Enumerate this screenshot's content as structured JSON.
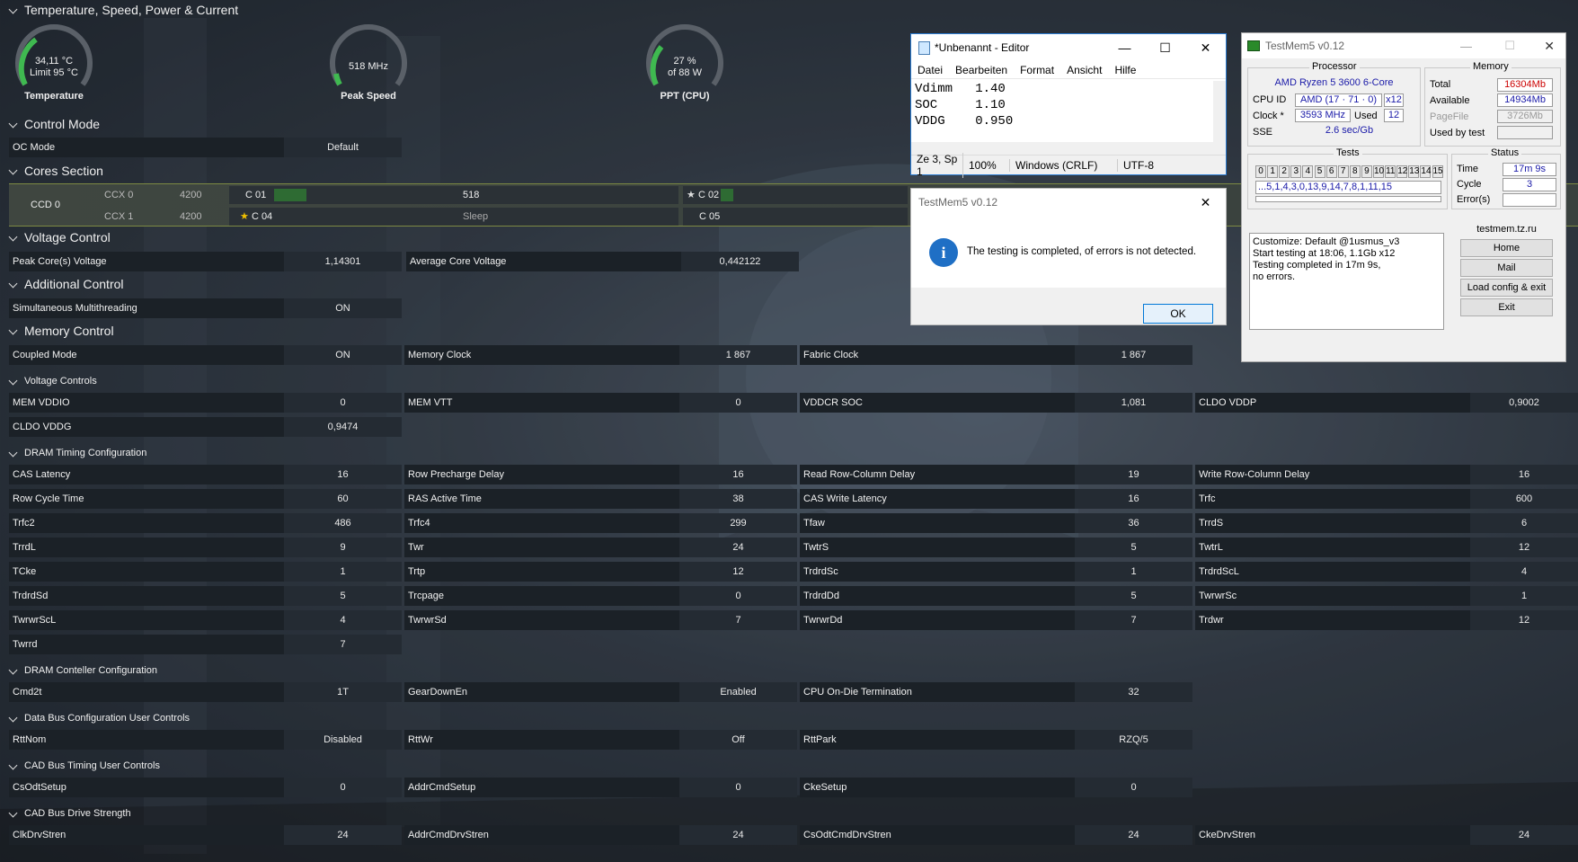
{
  "sections": {
    "temp": "Temperature, Speed, Power & Current",
    "control": "Control Mode",
    "cores": "Cores Section",
    "voltage": "Voltage Control",
    "additional": "Additional Control",
    "memory": "Memory Control",
    "vcontrols": "Voltage Controls",
    "dram": "DRAM Timing Configuration",
    "dramctl": "DRAM Conteller Configuration",
    "databus": "Data Bus Configuration User Controls",
    "cadtiming": "CAD Bus Timing User Controls",
    "caddrive": "CAD Bus Drive Strength"
  },
  "gauges": [
    {
      "l1": "34,11 °C",
      "l2": "Limit 95 °C",
      "cap": "Temperature",
      "fill": 0.36
    },
    {
      "l1": "518  MHz",
      "l2": "",
      "cap": "Peak Speed",
      "fill": 0.1
    },
    {
      "l1": "27 %",
      "l2": "of 88 W",
      "cap": "PPT (CPU)",
      "fill": 0.27
    }
  ],
  "oc": {
    "label": "OC Mode",
    "value": "Default"
  },
  "cores": {
    "ccd": "CCD 0",
    "ccx0": "CCX 0",
    "ccx0_freq": "4200",
    "ccx1": "CCX 1",
    "ccx1_freq": "4200",
    "c01": "C 01",
    "c01_val": "518",
    "c02": "C 02",
    "c04": "C 04",
    "c04_val": "Sleep",
    "c05": "C 05"
  },
  "voltage": [
    {
      "label": "Peak Core(s) Voltage",
      "value": "1,14301"
    },
    {
      "label": "Average Core Voltage",
      "value": "0,442122"
    }
  ],
  "smt": {
    "label": "Simultaneous Multithreading",
    "value": "ON"
  },
  "memctl": [
    {
      "label": "Coupled Mode",
      "value": "ON"
    },
    {
      "label": "Memory Clock",
      "value": "1 867"
    },
    {
      "label": "Fabric Clock",
      "value": "1 867"
    }
  ],
  "vctl": [
    {
      "label": "MEM VDDIO",
      "value": "0"
    },
    {
      "label": "MEM VTT",
      "value": "0"
    },
    {
      "label": "VDDCR SOC",
      "value": "1,081"
    },
    {
      "label": "CLDO VDDP",
      "value": "0,9002"
    },
    {
      "label": "CLDO VDDG",
      "value": "0,9474"
    }
  ],
  "timings": [
    {
      "label": "CAS Latency",
      "value": "16"
    },
    {
      "label": "Row Precharge Delay",
      "value": "16"
    },
    {
      "label": "Read Row-Column Delay",
      "value": "19"
    },
    {
      "label": "Write Row-Column Delay",
      "value": "16"
    },
    {
      "label": "Row Cycle Time",
      "value": "60"
    },
    {
      "label": "RAS Active Time",
      "value": "38"
    },
    {
      "label": "CAS Write Latency",
      "value": "16"
    },
    {
      "label": "Trfc",
      "value": "600"
    },
    {
      "label": "Trfc2",
      "value": "486"
    },
    {
      "label": "Trfc4",
      "value": "299"
    },
    {
      "label": "Tfaw",
      "value": "36"
    },
    {
      "label": "TrrdS",
      "value": "6"
    },
    {
      "label": "TrrdL",
      "value": "9"
    },
    {
      "label": "Twr",
      "value": "24"
    },
    {
      "label": "TwtrS",
      "value": "5"
    },
    {
      "label": "TwtrL",
      "value": "12"
    },
    {
      "label": "TCke",
      "value": "1"
    },
    {
      "label": "Trtp",
      "value": "12"
    },
    {
      "label": "TrdrdSc",
      "value": "1"
    },
    {
      "label": "TrdrdScL",
      "value": "4"
    },
    {
      "label": "TrdrdSd",
      "value": "5"
    },
    {
      "label": "Trcpage",
      "value": "0"
    },
    {
      "label": "TrdrdDd",
      "value": "5"
    },
    {
      "label": "TwrwrSc",
      "value": "1"
    },
    {
      "label": "TwrwrScL",
      "value": "4"
    },
    {
      "label": "TwrwrSd",
      "value": "7"
    },
    {
      "label": "TwrwrDd",
      "value": "7"
    },
    {
      "label": "Trdwr",
      "value": "12"
    },
    {
      "label": "Twrrd",
      "value": "7"
    }
  ],
  "dramctl": [
    {
      "label": "Cmd2t",
      "value": "1T"
    },
    {
      "label": "GearDownEn",
      "value": "Enabled"
    },
    {
      "label": "CPU On-Die Termination",
      "value": "32"
    }
  ],
  "databus": [
    {
      "label": "RttNom",
      "value": "Disabled"
    },
    {
      "label": "RttWr",
      "value": "Off"
    },
    {
      "label": "RttPark",
      "value": "RZQ/5"
    }
  ],
  "cadtiming": [
    {
      "label": "CsOdtSetup",
      "value": "0"
    },
    {
      "label": "AddrCmdSetup",
      "value": "0"
    },
    {
      "label": "CkeSetup",
      "value": "0"
    }
  ],
  "caddrive": [
    {
      "label": "ClkDrvStren",
      "value": "24"
    },
    {
      "label": "AddrCmdDrvStren",
      "value": "24"
    },
    {
      "label": "CsOdtCmdDrvStren",
      "value": "24"
    },
    {
      "label": "CkeDrvStren",
      "value": "24"
    }
  ],
  "editor": {
    "title": "*Unbenannt - Editor",
    "menu": [
      "Datei",
      "Bearbeiten",
      "Format",
      "Ansicht",
      "Hilfe"
    ],
    "lines": [
      "Vdimm   1.40",
      "SOC     1.10",
      "VDDG    0.950"
    ],
    "status": [
      "Ze 3, Sp 1",
      "100%",
      "Windows (CRLF)",
      "UTF-8"
    ]
  },
  "dialog": {
    "title": "TestMem5 v0.12",
    "message": "The testing is completed, of errors is not detected.",
    "ok": "OK"
  },
  "testmem": {
    "title": "TestMem5 v0.12",
    "processor_legend": "Processor",
    "cpu_name": "AMD Ryzen 5 3600 6-Core",
    "cpuid_label": "CPU ID",
    "cpuid": "AMD  (17 · 71 · 0)",
    "threads": "x12",
    "clock_label": "Clock *",
    "clock": "3593 MHz",
    "used_label": "Used",
    "used": "12",
    "sse_label": "SSE",
    "sse": "2.6 sec/Gb",
    "memory_legend": "Memory",
    "total_label": "Total",
    "total": "16304Mb",
    "avail_label": "Available",
    "avail": "14934Mb",
    "pagefile_label": "PageFile",
    "pagefile": "3726Mb",
    "usedby_label": "Used by test",
    "usedby": "",
    "tests_legend": "Tests",
    "tests": [
      "0",
      "1",
      "2",
      "3",
      "4",
      "5",
      "6",
      "7",
      "8",
      "9",
      "10",
      "11",
      "12",
      "13",
      "14",
      "15"
    ],
    "sequence": "...5,1,4,3,0,13,9,14,7,8,1,11,15",
    "status_legend": "Status",
    "time_label": "Time",
    "time": "17m 9s",
    "cycle_label": "Cycle",
    "cycle": "3",
    "errors_label": "Error(s)",
    "errors": "",
    "log": [
      "Customize: Default @1usmus_v3",
      "Start testing at 18:06, 1.1Gb x12",
      "Testing completed in 17m 9s,",
      "no errors."
    ],
    "site": "testmem.tz.ru",
    "buttons": [
      "Home",
      "Mail",
      "Load config & exit",
      "Exit"
    ]
  }
}
